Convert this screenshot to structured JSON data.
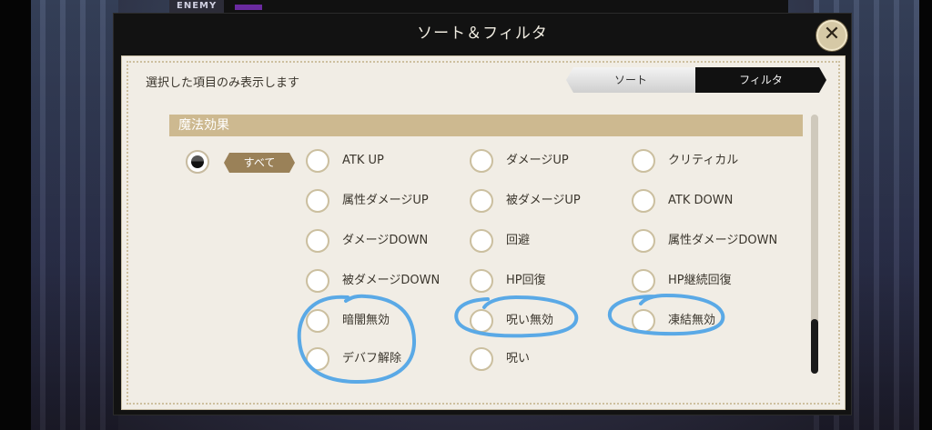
{
  "hud": {
    "enemy_label": "ENEMY"
  },
  "modal": {
    "title": "ソート＆フィルタ",
    "close_symbol": "✕",
    "subtitle": "選択した項目のみ表示します",
    "tabs": {
      "sort": "ソート",
      "filter": "フィルタ",
      "active": "filter"
    },
    "section_title": "魔法効果",
    "all_label": "すべて",
    "options": {
      "col1": [
        "ATK UP",
        "属性ダメージUP",
        "ダメージDOWN",
        "被ダメージDOWN",
        "暗闇無効",
        "デバフ解除"
      ],
      "col2": [
        "ダメージUP",
        "被ダメージUP",
        "回避",
        "HP回復",
        "呪い無効",
        "呪い"
      ],
      "col3": [
        "クリティカル",
        "ATK DOWN",
        "属性ダメージDOWN",
        "HP継続回復",
        "凍結無効"
      ]
    }
  },
  "colors": {
    "annotation": "#5aa9e6",
    "section": "#cdb990",
    "all_badge": "#9a8158"
  }
}
